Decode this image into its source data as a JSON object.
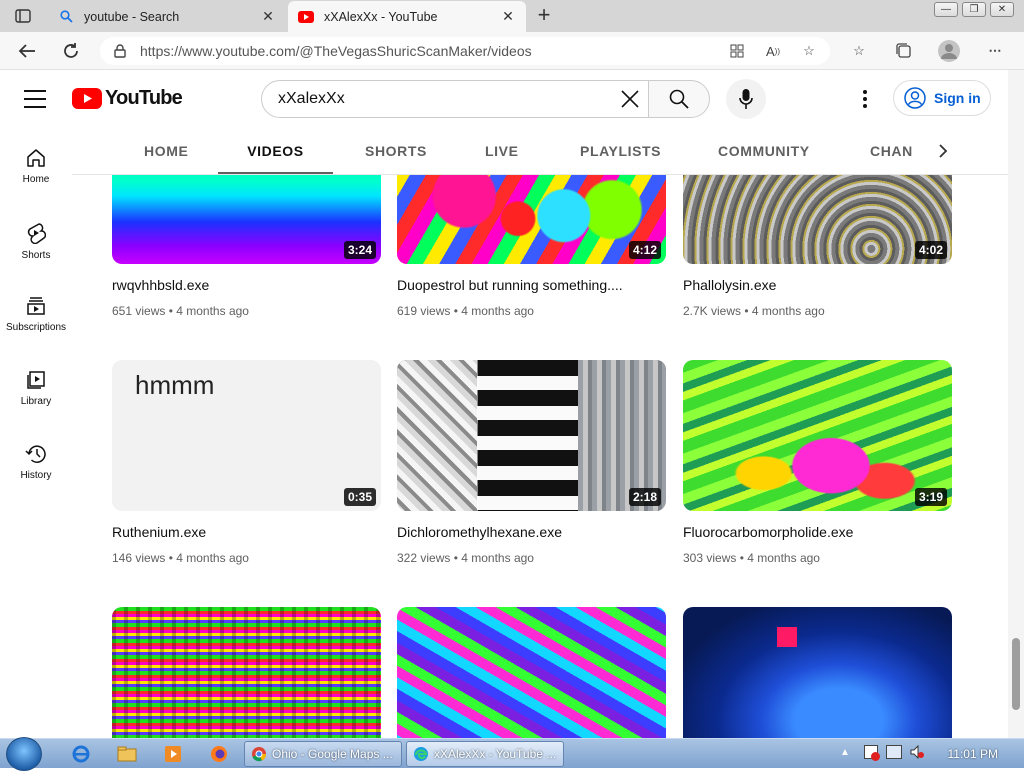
{
  "browser": {
    "tabs": [
      {
        "title": "youtube - Search",
        "active": false
      },
      {
        "title": "xXAlexXx - YouTube",
        "active": true
      }
    ],
    "url": "https://www.youtube.com/@TheVegasShuricScanMaker/videos"
  },
  "youtube": {
    "logo_text": "YouTube",
    "search_value": "xXalexXx",
    "sign_in_label": "Sign in",
    "brand_color": "#ff0000",
    "sidebar": [
      {
        "label": "Home",
        "icon": "home-icon"
      },
      {
        "label": "Shorts",
        "icon": "shorts-icon"
      },
      {
        "label": "Subscriptions",
        "icon": "subscriptions-icon"
      },
      {
        "label": "Library",
        "icon": "library-icon"
      },
      {
        "label": "History",
        "icon": "history-icon"
      }
    ],
    "channel_tabs": [
      {
        "label": "HOME",
        "active": false
      },
      {
        "label": "VIDEOS",
        "active": true
      },
      {
        "label": "SHORTS",
        "active": false
      },
      {
        "label": "LIVE",
        "active": false
      },
      {
        "label": "PLAYLISTS",
        "active": false
      },
      {
        "label": "COMMUNITY",
        "active": false
      },
      {
        "label": "CHAN",
        "active": false
      }
    ],
    "videos": [
      {
        "title": "rwqvhhbsld.exe",
        "views": "651 views",
        "age": "4 months ago",
        "duration": "3:24"
      },
      {
        "title": "Duopestrol but running something....",
        "views": "619 views",
        "age": "4 months ago",
        "duration": "4:12"
      },
      {
        "title": "Phallolysin.exe",
        "views": "2.7K views",
        "age": "4 months ago",
        "duration": "4:02"
      },
      {
        "title": "Ruthenium.exe",
        "views": "146 views",
        "age": "4 months ago",
        "duration": "0:35",
        "thumb_text": "hmmm"
      },
      {
        "title": "Dichloromethylhexane.exe",
        "views": "322 views",
        "age": "4 months ago",
        "duration": "2:18"
      },
      {
        "title": "Fluorocarbomorpholide.exe",
        "views": "303 views",
        "age": "4 months ago",
        "duration": "3:19"
      },
      {
        "title": "",
        "views": "",
        "age": "",
        "duration": ""
      },
      {
        "title": "",
        "views": "",
        "age": "",
        "duration": ""
      },
      {
        "title": "",
        "views": "",
        "age": "",
        "duration": ""
      }
    ]
  },
  "taskbar": {
    "tasks": [
      {
        "label": "Ohio - Google Maps ...",
        "active": false
      },
      {
        "label": "xXAlexXx - YouTube ...",
        "active": true
      }
    ],
    "clock": "11:01 PM"
  }
}
